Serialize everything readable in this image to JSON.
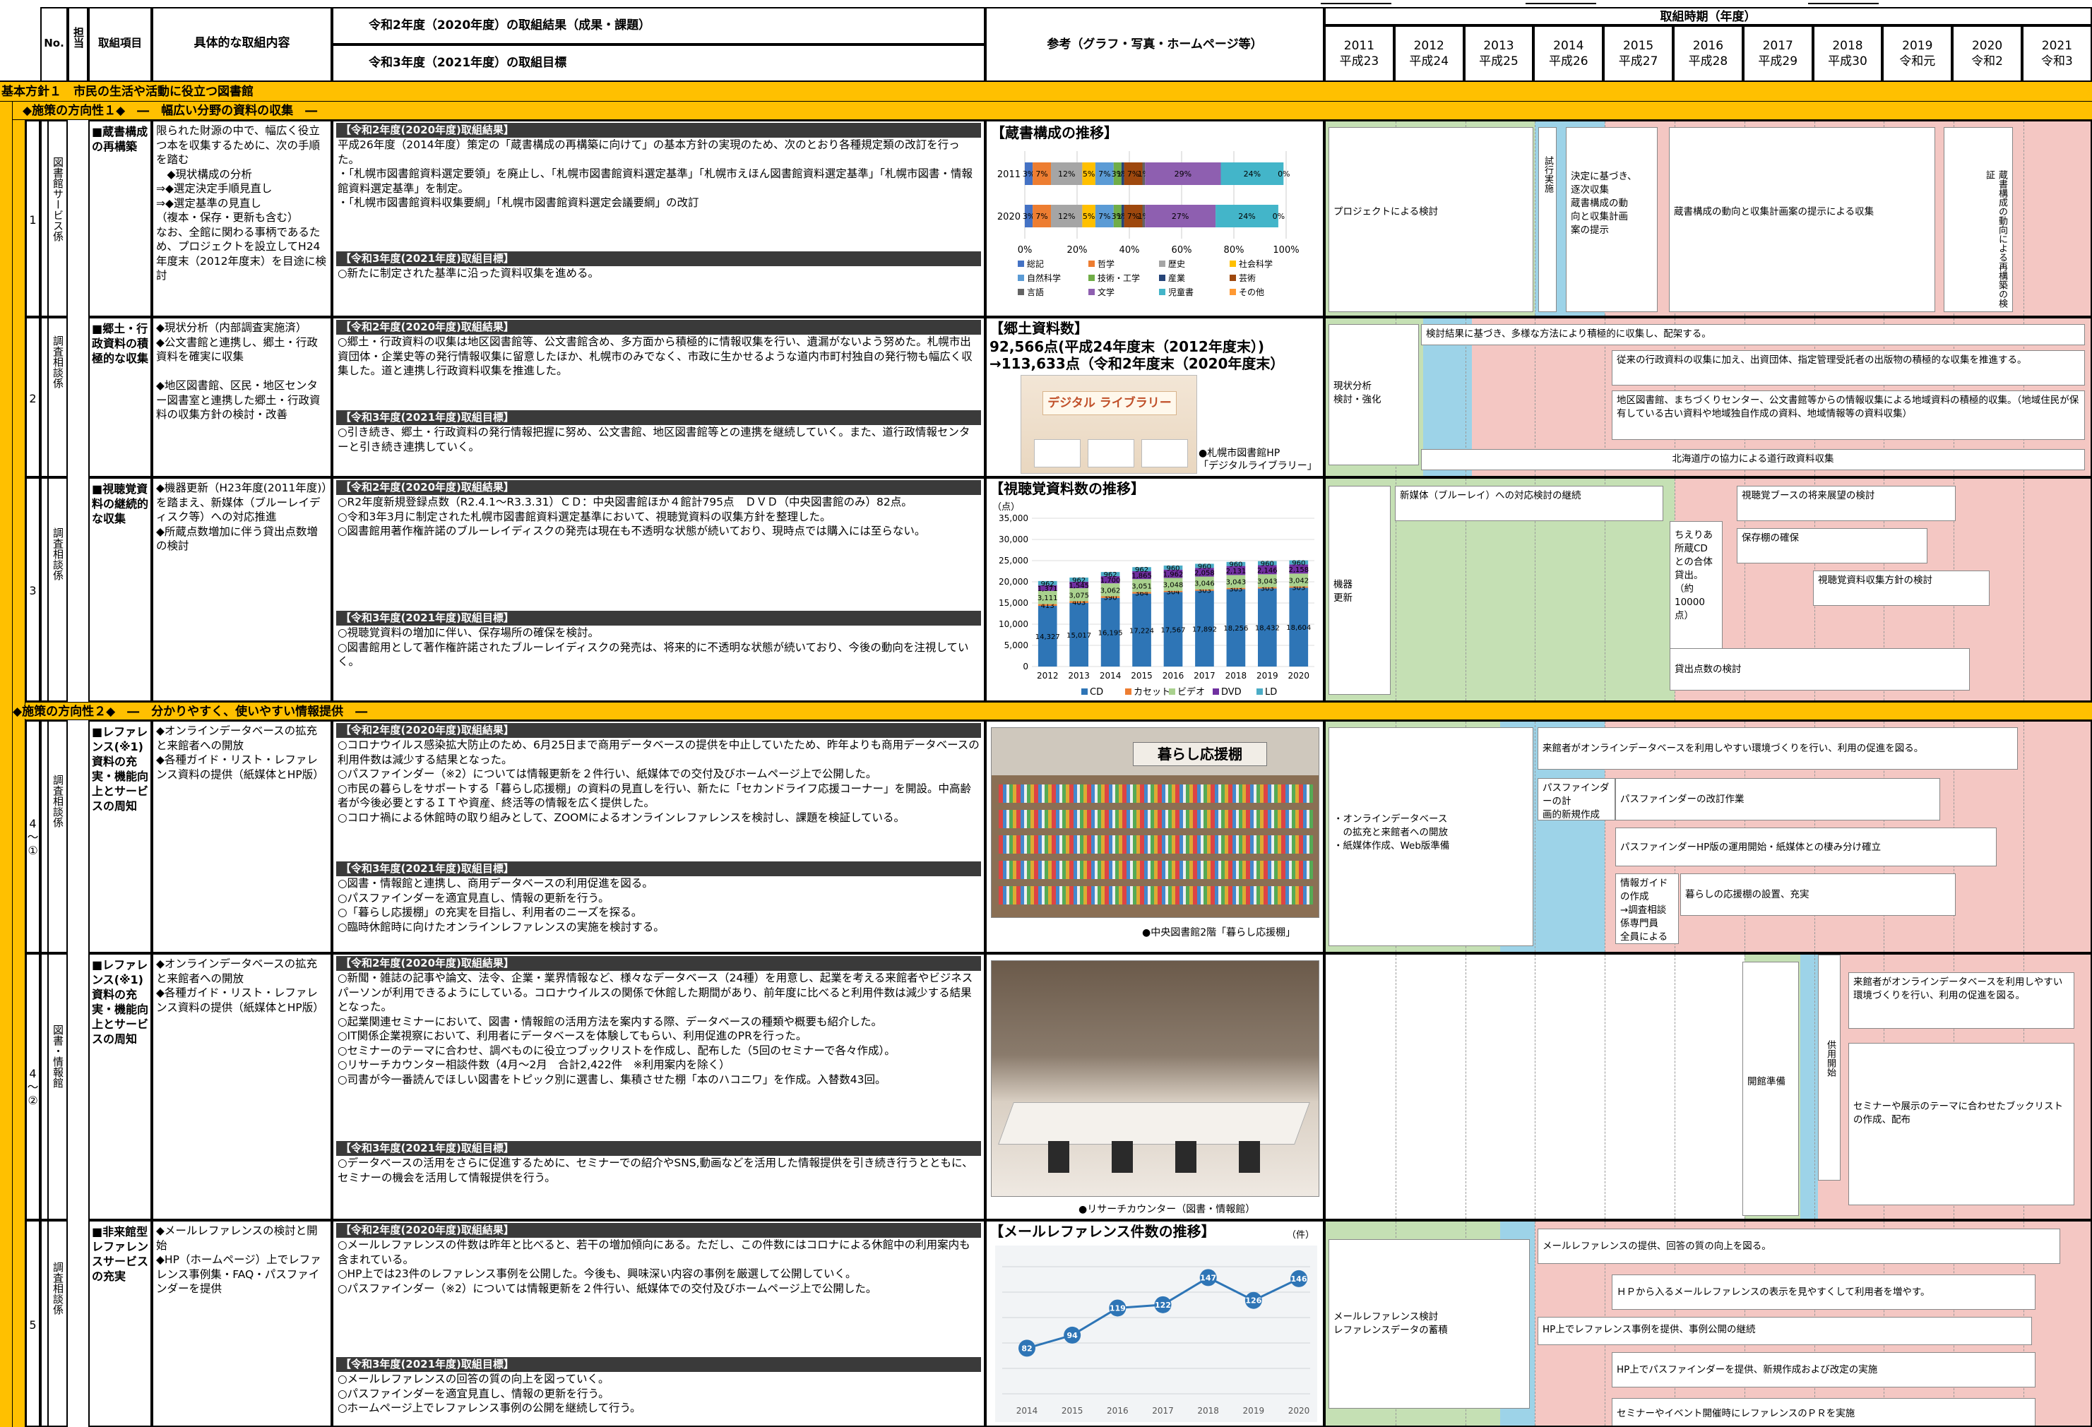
{
  "header": {
    "no": "No.",
    "tanto": "担当",
    "item": "取組項目",
    "content": "具体的な取組内容",
    "r2_result": "令和2年度（2020年度）の取組結果（成果・課題）",
    "r3_goal": "令和3年度（2021年度）の取組目標",
    "ref": "参考（グラフ・写真・ホームページ等）",
    "period": "取組時期（年度）",
    "years": [
      {
        "y": "2011",
        "w": "平成23"
      },
      {
        "y": "2012",
        "w": "平成24"
      },
      {
        "y": "2013",
        "w": "平成25"
      },
      {
        "y": "2014",
        "w": "平成26"
      },
      {
        "y": "2015",
        "w": "平成27"
      },
      {
        "y": "2016",
        "w": "平成28"
      },
      {
        "y": "2017",
        "w": "平成29"
      },
      {
        "y": "2018",
        "w": "平成30"
      },
      {
        "y": "2019",
        "w": "令和元"
      },
      {
        "y": "2020",
        "w": "令和2"
      },
      {
        "y": "2021",
        "w": "令和3"
      }
    ]
  },
  "policy": "基本方針１　市民の生活や活動に役立つ図書館",
  "dir1": "◆施策の方向性１◆　―　幅広い分野の資料の収集　―",
  "dir2": "◆施策の方向性２◆　―　分かりやすく、使いやすい情報提供　―",
  "rows": [
    {
      "no": "1",
      "tanto": "図書館サービス係",
      "item": "■蔵書構成の再構築",
      "content": "限られた財源の中で、幅広く役立つ本を収集するために、次の手順を踏む\n　◆現状構成の分析\n⇒◆選定決定手順見直し\n⇒◆選定基準の見直し\n（複本・保存・更新も含む）\nなお、全館に関わる事柄であるため、プロジェクトを設立してH24年度末（2012年度末）を目途に検討",
      "r2_label": "【令和2年度(2020年度)取組結果】",
      "r2": "平成26年度（2014年度）策定の「蔵書構成の再構築に向けて」の基本方針の実現のため、次のとおり各種規定類の改訂を行った。\n・「札幌市図書館資料選定要領」を廃止し、「札幌市図書館資料選定基準」「札幌市えほん図書館資料選定基準」「札幌市図書・情報館資料選定基準」を制定。\n・「札幌市図書館資料収集要綱」「札幌市図書館資料選定会議要綱」の改訂",
      "r3_label": "【令和3年度(2021年度)取組目標】",
      "r3": "○新たに制定された基準に沿った資料収集を進める。",
      "ref_title": "【蔵書構成の推移】"
    },
    {
      "no": "2",
      "tanto": "調査相談係",
      "item": "■郷土・行政資料の積極的な収集",
      "content": "◆現状分析（内部調査実施済）\n◆公文書館と連携し、郷土・行政資料を確実に収集\n\n◆地区図書館、区民・地区センター図書室と連携した郷土・行政資料の収集方針の検討・改善",
      "r2_label": "【令和2年度(2020年度)取組結果】",
      "r2": "○郷土・行政資料の収集は地区図書館等、公文書館含め、多方面から積極的に情報収集を行い、遺漏がないよう努めた。札幌市出資団体・企業史等の発行情報収集に留意したほか、札幌市のみでなく、市政に生かせるような道内市町村独自の発行物も幅広く収集した。道と連携し行政資料収集を推進した。",
      "r3_label": "【令和3年度(2021年度)取組目標】",
      "r3": "○引き続き、郷土・行政資料の発行情報把握に努め、公文書館、地区図書館等との連携を継続していく。また、道行政情報センターと引き続き連携していく。",
      "ref_title": "【郷土資料数】",
      "ref_l1": "92,566点(平成24年度末（2012年度末）)",
      "ref_l2": "→113,633点（令和2年度末（2020年度末）",
      "ref_banner": "デジタル ライブラリー",
      "ref_caption": "●札幌市図書館HP\n「デジタルライブラリー」"
    },
    {
      "no": "3",
      "tanto": "調査相談係",
      "item": "■視聴覚資料の継続的な収集",
      "content": "◆機器更新（H23年度(2011年度)）を踏まえ、新媒体（ブルーレイディスク等）への対応推進\n◆所蔵点数増加に伴う貸出点数増の検討",
      "r2_label": "【令和2年度(2020年度)取組結果】",
      "r2": "○R2年度新規登録点数（R2.4.1～R3.3.31）ＣＤ：中央図書館ほか４館計795点　ＤＶＤ（中央図書館のみ）82点。\n○令和3年3月に制定された札幌市図書館資料選定基準において、視聴覚資料の収集方針を整理した。\n○図書館用著作権許諾のブルーレイディスクの発売は現在も不透明な状態が続いており、現時点では購入には至らない。",
      "r3_label": "【令和3年度(2021年度)取組目標】",
      "r3": "○視聴覚資料の増加に伴い、保存場所の確保を検討。\n○図書館用として著作権許諾されたブルーレイディスクの発売は、将来的に不透明な状態が続いており、今後の動向を注視していく。",
      "ref_title": "【視聴覚資料数の推移】"
    },
    {
      "no": "4\n～\n①",
      "tanto": "調査相談係",
      "item": "■レファレンス(※1)資料の充実・機能向上とサービスの周知",
      "content": "◆オンラインデータベースの拡充と来館者への開放\n◆各種ガイド・リスト・レファレンス資料の提供（紙媒体とHP版）",
      "r2_label": "【令和2年度(2020年度)取組結果】",
      "r2": "○コロナウイルス感染拡大防止のため、6月25日まで商用データベースの提供を中止していたため、昨年よりも商用データベースの利用件数は減少する結果となった。\n○パスファインダー（※2）については情報更新を２件行い、紙媒体での交付及びホームページ上で公開した。\n○市民の暮らしをサポートする「暮らし応援棚」の資料の見直しを行い、新たに「セカンドライフ応援コーナー」を開設。中高齢者が今後必要とするＩＴや資産、終活等の情報を広く提供した。\n○コロナ禍による休館時の取り組みとして、ZOOMによるオンラインレファレンスを検討し、課題を検証している。",
      "r3_label": "【令和3年度(2021年度)取組目標】",
      "r3": "○図書・情報館と連携し、商用データベースの利用促進を図る。\n○パスファインダーを適宜見直し、情報の更新を行う。\n○「暮らし応援棚」の充実を目指し、利用者のニーズを探る。\n○臨時休館時に向けたオンラインレファレンスの実施を検討する。",
      "ref_sign": "暮らし応援棚",
      "ref_caption": "●中央図書館2階「暮らし応援棚」"
    },
    {
      "no": "4\n～\n②",
      "tanto": "図書・情報館",
      "item": "■レファレンス(※1)資料の充実・機能向上とサービスの周知",
      "content": "◆オンラインデータベースの拡充と来館者への開放\n◆各種ガイド・リスト・レファレンス資料の提供（紙媒体とHP版）",
      "r2_label": "【令和2年度(2020年度)取組結果】",
      "r2": "○新聞・雑誌の記事や論文、法令、企業・業界情報など、様々なデータベース（24種）を用意し、起業を考える来館者やビジネスパーソンが利用できるようにしている。コロナウイルスの関係で休館した期間があり、前年度に比べると利用件数は減少する結果となった。\n○起業関連セミナーにおいて、図書・情報館の活用方法を案内する際、データベースの種類や概要も紹介した。\n○IT関係企業視察において、利用者にデータベースを体験してもらい、利用促進のPRを行った。\n○セミナーのテーマに合わせ、調べものに役立つブックリストを作成し、配布した（5回のセミナーで各々作成）。\n○リサーチカウンター相談件数（4月～2月　合計2,422件　※利用案内を除く）\n○司書が今一番読んでほしい図書をトピック別に選書し、集積させた棚「本のハコニワ」を作成。入替数43回。",
      "r3_label": "【令和3年度(2021年度)取組目標】",
      "r3": "○データベースの活用をさらに促進するために、セミナーでの紹介やSNS,動画などを活用した情報提供を引き続き行うとともに、セミナーの機会を活用して情報提供を行う。",
      "ref_caption": "●リサーチカウンター（図書・情報館）"
    },
    {
      "no": "5",
      "tanto": "調査相談係",
      "item": "■非来館型レファレンスサービスの充実",
      "content": "◆メールレファレンスの検討と開始\n◆HP（ホームページ）上でレファレンス事例集・FAQ・パスファインダーを提供",
      "r2_label": "【令和2年度(2020年度)取組結果】",
      "r2": "○メールレファレンスの件数は昨年と比べると、若干の増加傾向にある。ただし、この件数にはコロナによる休館中の利用案内も含まれている。\n○HP上では23件のレファレンス事例を公開した。今後も、興味深い内容の事例を厳選して公開していく。\n○パスファインダー（※2）については情報更新を２件行い、紙媒体での交付及びホームページ上で公開した。",
      "r3_label": "【令和3年度(2021年度)取組目標】",
      "r3": "○メールレファレンスの回答の質の向上を図っていく。\n○パスファインダーを適宜見直し、情報の更新を行う。\n○ホームページ上でレファレンス事例の公開を継続して行う。",
      "ref_title": "【メールレファレンス件数の推移】",
      "ref_unit": "（件）"
    }
  ],
  "timeline": {
    "r1": {
      "b1": "プロジェクトによる検討",
      "b2": "試行実施\n\n要領改正",
      "b3": "決定に基づき、\n逐次収集\n蔵書構成の動\n向と収集計画\n案の提示",
      "b4": "蔵書構成の動向と収集計画案の提示による収集",
      "b5": "蔵書構成の動向による再構築の検証"
    },
    "r2": {
      "b1": "現状分析\n検討・強化",
      "b2": "検討結果に基づき、多様な方法により積極的に収集し、配架する。",
      "b3": "従来の行政資料の収集に加え、出資団体、指定管理受託者の出版物の積極的な収集を推進する。",
      "b4": "地区図書館、まちづくりセンター、公文書館等からの情報収集による地域資料の積極的収集。（地域住民が保有している古い資料や地域独自作成の資料、地域情報等の資料収集）",
      "b5": "北海道庁の協力による道行政資料収集"
    },
    "r3": {
      "b1": "機器\n更新",
      "b2": "新媒体（ブルーレイ）への対応検討の継続",
      "b3": "ちえりあ\n所蔵CD\nとの合体\n貸出。\n（約10000\n点）",
      "b4": "視聴覚ブースの将来展望の検討",
      "b5": "保存棚の確保",
      "b6": "視聴覚資料収集方針の検討",
      "b7": "貸出点数の検討"
    },
    "r4": {
      "b1": "・オンラインデータベース\n　の拡充と来館者への開放\n・紙媒体作成、Web版準備",
      "b2": "来館者がオンラインデータベースを利用しやすい環境づくりを行い、利用の促進を図る。",
      "b3": "パスファインダーの計\n画的新規作成",
      "b4": "パスファインダーの改訂作業",
      "b5": "パスファインダーHP版の運用開始・紙媒体との棲み分け確立",
      "b6": "情報ガイドの作成\n→調査相談係専門員\n全員による計画的作\n成",
      "b7": "暮らしの応援棚の設置、充実"
    },
    "r5": {
      "b1": "開館準備",
      "b2": "供用開始",
      "b3": "来館者がオンラインデータベースを利用しやすい環境づくりを行い、利用の促進を図る。",
      "b4": "セミナーや展示のテーマに合わせたブックリストの作成、配布"
    },
    "r6": {
      "b1": "メールレファレンス検討\nレファレンスデータの蓄積",
      "b2": "メールレファレンスの提供、回答の質の向上を図る。",
      "b3": "ＨＰから入るメールレファレンスの表示を見やすくして利用者を増やす。",
      "b4": "HP上でレファレンス事例を提供、事例公開の継続",
      "b5": "HP上でパスファインダーを提供、新規作成および改定の実施",
      "b6": "セミナーやイベント開催時にレファレンスのＰＲを実施"
    }
  },
  "chart_data": [
    {
      "type": "bar",
      "title": "【蔵書構成の推移】",
      "orientation": "horizontal-stacked-100",
      "categories": [
        "2011",
        "2020"
      ],
      "series": [
        {
          "name": "総記",
          "values": [
            3,
            3
          ],
          "color": "#4472c4"
        },
        {
          "name": "哲学",
          "values": [
            7,
            7
          ],
          "color": "#ed7d31"
        },
        {
          "name": "歴史",
          "values": [
            12,
            12
          ],
          "color": "#a5a5a5"
        },
        {
          "name": "社会科学",
          "values": [
            5,
            5
          ],
          "color": "#ffc000"
        },
        {
          "name": "自然科学",
          "values": [
            7,
            7
          ],
          "color": "#5b9bd5"
        },
        {
          "name": "技術・工学",
          "values": [
            3,
            3
          ],
          "color": "#70ad47"
        },
        {
          "name": "産業",
          "values": [
            1,
            1
          ],
          "color": "#264478"
        },
        {
          "name": "芸術",
          "values": [
            7,
            7
          ],
          "color": "#9e480e"
        },
        {
          "name": "言語",
          "values": [
            1,
            1
          ],
          "color": "#636363"
        },
        {
          "name": "文学",
          "values": [
            29,
            27
          ],
          "color": "#8e5fb0"
        },
        {
          "name": "児童書",
          "values": [
            24,
            24
          ],
          "color": "#43b5c9"
        },
        {
          "name": "その他",
          "values": [
            0,
            0
          ],
          "color": "#ff9933"
        }
      ],
      "labels": {
        "2011": [
          "3%",
          "7%",
          "12%",
          "5%",
          "7%",
          "3%",
          "1%",
          "7%",
          "1%",
          "29%",
          "24%",
          "0%"
        ],
        "2020": [
          "3%",
          "7%",
          "12%",
          "5%",
          "7%",
          "3%",
          "1%",
          "7%",
          "1%",
          "27%",
          "24%",
          "0%"
        ]
      },
      "xticks": [
        "0%",
        "20%",
        "40%",
        "60%",
        "80%",
        "100%"
      ],
      "legend_rows": [
        [
          "総記",
          "哲学",
          "歴史",
          "社会科学"
        ],
        [
          "自然科学",
          "技術・工学",
          "産業",
          "芸術"
        ],
        [
          "言語",
          "文学",
          "児童書",
          "その他"
        ]
      ]
    },
    {
      "type": "bar",
      "title": "【視聴覚資料数の推移】",
      "orientation": "vertical-stacked",
      "ylabel": "（点）",
      "categories": [
        "2012",
        "2013",
        "2014",
        "2015",
        "2016",
        "2017",
        "2018",
        "2019",
        "2020"
      ],
      "ylim": [
        0,
        35000
      ],
      "yticks": [
        "0",
        "5,000",
        "10,000",
        "15,000",
        "20,000",
        "25,000",
        "30,000",
        "35,000"
      ],
      "series": [
        {
          "name": "CD",
          "values": [
            14327,
            15017,
            16195,
            17224,
            17567,
            17892,
            18256,
            18432,
            18604
          ],
          "labels": [
            "14,327",
            "15,017",
            "16,195",
            "17,224",
            "17,567",
            "17,892",
            "18,256",
            "18,432",
            "18,604"
          ],
          "color": "#2e75b6"
        },
        {
          "name": "カセット",
          "values": [
            413,
            403,
            390,
            364,
            304,
            303,
            303,
            303,
            303
          ],
          "labels": [
            "413",
            "403",
            "390",
            "364",
            "304",
            "303",
            "303",
            "303",
            "303"
          ],
          "color": "#ed7d31"
        },
        {
          "name": "ビデオ",
          "values": [
            3111,
            3075,
            3062,
            3051,
            3048,
            3046,
            3043,
            3043,
            3042
          ],
          "labels": [
            "3,111",
            "3,075",
            "3,062",
            "3,051",
            "3,048",
            "3,046",
            "3,043",
            "3,043",
            "3,042"
          ],
          "color": "#a9d18e"
        },
        {
          "name": "DVD",
          "values": [
            1371,
            1545,
            1700,
            1865,
            1962,
            2058,
            2131,
            2146,
            2158
          ],
          "labels": [
            "1,371",
            "1,545",
            "1,700",
            "1,865",
            "1,962",
            "2,058",
            "2,131",
            "2,146",
            "2,158"
          ],
          "color": "#7030a0"
        },
        {
          "name": "LD",
          "values": [
            962,
            962,
            962,
            962,
            960,
            960,
            960,
            960,
            960
          ],
          "labels": [
            "962",
            "962",
            "962",
            "962",
            "960",
            "960",
            "960",
            "960",
            "960"
          ],
          "color": "#4bacc6"
        }
      ]
    },
    {
      "type": "line",
      "title": "【メールレファレンス件数の推移】",
      "ylabel": "（件）",
      "x": [
        "2014",
        "2015",
        "2016",
        "2017",
        "2018",
        "2019",
        "2020"
      ],
      "series": [
        {
          "name": "",
          "values": [
            82,
            94,
            119,
            122,
            147,
            126,
            146
          ],
          "color": "#2e75b6"
        }
      ]
    }
  ]
}
